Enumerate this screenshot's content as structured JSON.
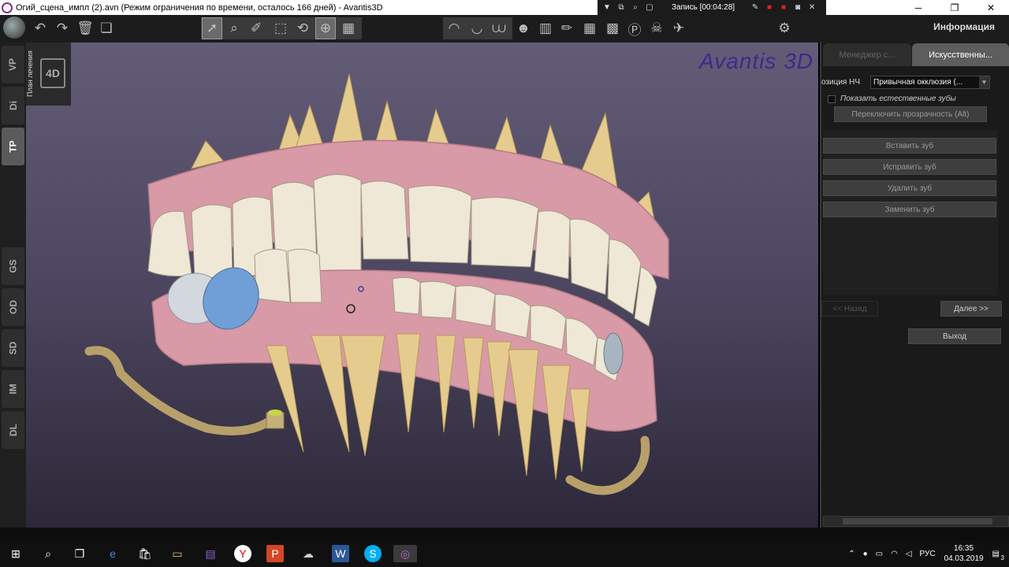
{
  "titlebar": {
    "title": "Огий_сцена_импл (2).avn (Режим ограничения по времени, осталось 166 дней) - Avantis3D",
    "recording": "Запись [00:04:28]"
  },
  "toolbar": {
    "info_label": "Информация"
  },
  "left_tabs": [
    "VP",
    "Di",
    "TP",
    "GS",
    "OD",
    "SD",
    "IM",
    "DL"
  ],
  "viewport": {
    "plan_label": "План лечения",
    "plan_icon": "4D",
    "brand": "Avantis 3D"
  },
  "right_panel": {
    "tabs": [
      "Менеджер с...",
      "Искусственны..."
    ],
    "position_label": "озиция НЧ",
    "position_value": "Привычная окклюзия (...",
    "show_natural_label": "Показать естественные зубы",
    "toggle_transparency": "Переключить прозрачность (Alt)",
    "insert_tooth": "Вставить зуб",
    "fix_tooth": "Исправить зуб",
    "delete_tooth": "Удалить зуб",
    "replace_tooth": "Заменить зуб",
    "back": "<<   Назад",
    "next": "Далее   >>",
    "exit": "Выход"
  },
  "taskbar": {
    "lang": "РУС",
    "time": "16:35",
    "date": "04.03.2019",
    "notification_count": "3"
  },
  "colors": {
    "brand": "#3a2a8c",
    "gum": "#d79aa6",
    "tooth": "#efe8d6",
    "root": "#e5cc8e",
    "implant": "#6f9fd6"
  }
}
